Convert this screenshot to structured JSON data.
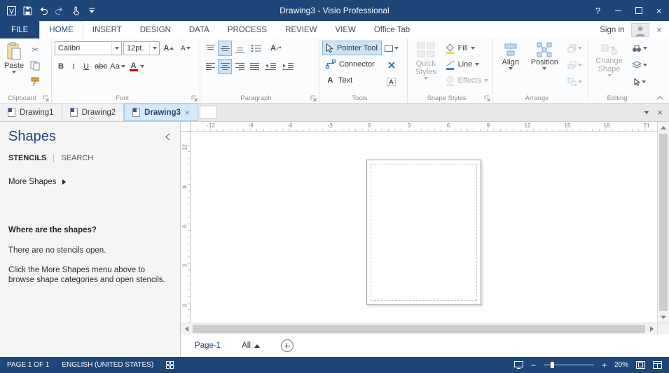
{
  "app": {
    "title": "Drawing3 - Visio Professional",
    "help": "?"
  },
  "icons": {
    "cut": "✂",
    "close": "×"
  },
  "ribbon_tabs": [
    "FILE",
    "HOME",
    "INSERT",
    "DESIGN",
    "DATA",
    "PROCESS",
    "REVIEW",
    "VIEW",
    "Office Tab"
  ],
  "account": {
    "sign_in": "Sign in"
  },
  "ribbon": {
    "clipboard": {
      "label": "Clipboard",
      "paste": "Paste"
    },
    "font": {
      "label": "Font",
      "family": "Calibri",
      "size": "12pt.",
      "bold": "B",
      "italic": "I",
      "underline": "U",
      "strikethrough": "abc",
      "case_toggle": "Aa",
      "font_color": "A"
    },
    "paragraph": {
      "label": "Paragraph"
    },
    "tools": {
      "label": "Tools",
      "pointer_tool": "Pointer Tool",
      "connector": "Connector",
      "text": "Text",
      "text_icon": "A"
    },
    "shape_styles": {
      "label": "Shape Styles",
      "quick_styles": "Quick Styles",
      "fill": "Fill",
      "line": "Line",
      "effects": "Effects"
    },
    "arrange": {
      "label": "Arrange",
      "align": "Align",
      "position": "Position"
    },
    "editing": {
      "label": "Editing",
      "change_shape": "Change Shape"
    }
  },
  "document_tabs": [
    "Drawing1",
    "Drawing2",
    "Drawing3"
  ],
  "shapes_panel": {
    "title": "Shapes",
    "tab_stencils": "STENCILS",
    "tab_search": "SEARCH",
    "more_shapes": "More Shapes",
    "help_heading": "Where are the shapes?",
    "help_para1": "There are no stencils open.",
    "help_para2": "Click the More Shapes menu above to browse shape categories and open stencils."
  },
  "rulers": {
    "horizontal": [
      "-12",
      "-9",
      "-6",
      "-3",
      "0",
      "3",
      "6",
      "9",
      "12",
      "15",
      "18",
      "21"
    ],
    "vertical": [
      "12",
      "9",
      "6",
      "3",
      "0"
    ]
  },
  "page_controls": {
    "page_tab": "Page-1",
    "all": "All"
  },
  "status_bar": {
    "page_indicator": "PAGE 1 OF 1",
    "language": "ENGLISH (UNITED STATES)",
    "zoom_out": "−",
    "zoom_in": "+",
    "zoom_level": "20%"
  },
  "colors": {
    "titlebar": "#1e4678",
    "accent": "#1e4678",
    "selection": "#cce4f7",
    "fill_swatch": "#ffd34d",
    "line_swatch": "#4a7ebb",
    "font_color_swatch": "#c00000"
  }
}
